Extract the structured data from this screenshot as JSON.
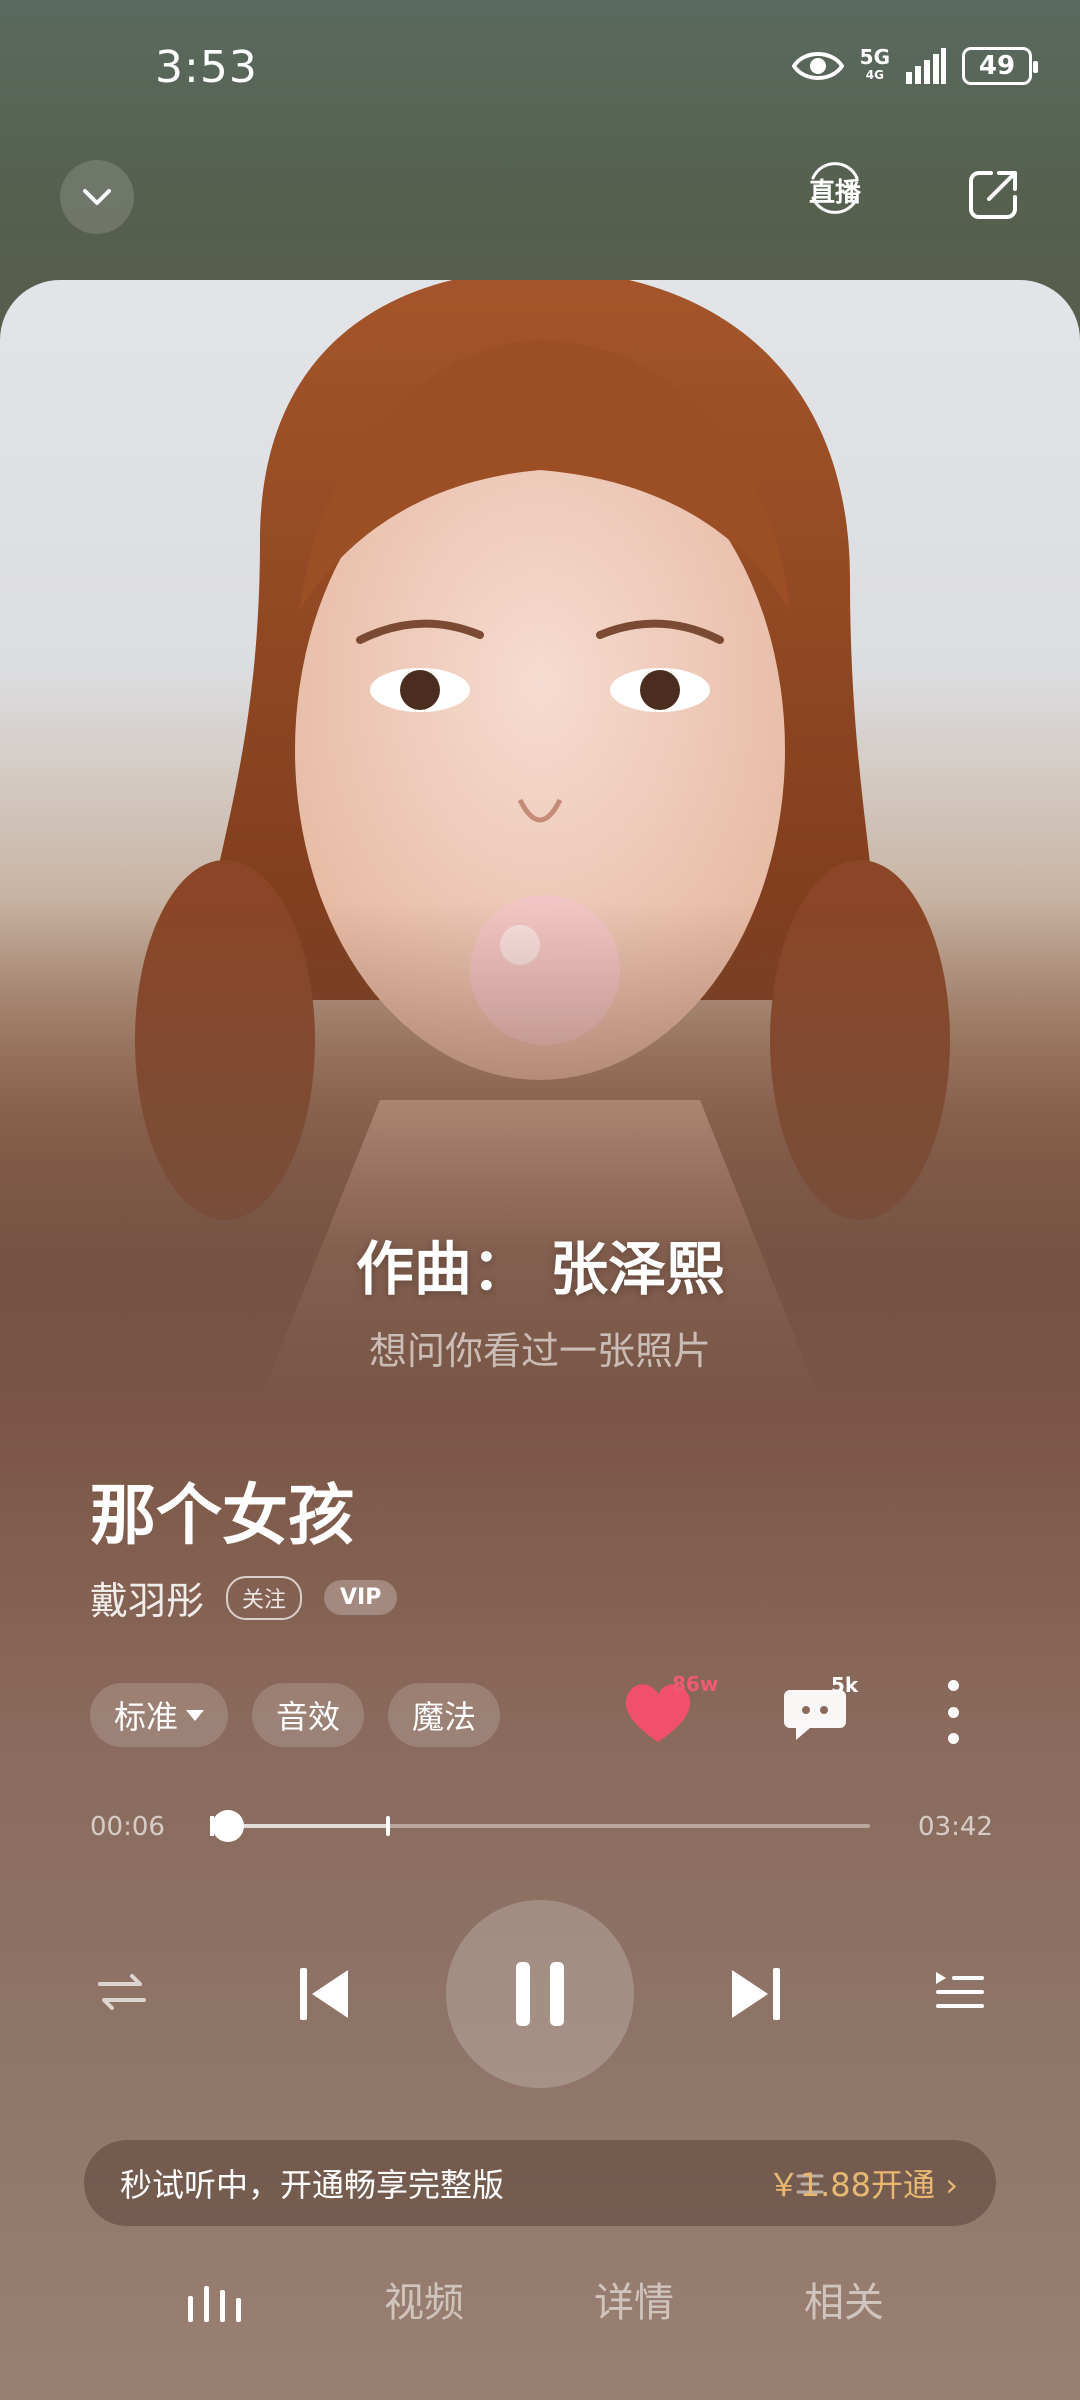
{
  "status_bar": {
    "time": "3:53",
    "network": "5G",
    "network_sub": "4G",
    "battery": "49"
  },
  "header": {
    "live_label": "直播"
  },
  "lyrics": {
    "current": "作曲： 张泽熙",
    "next": "想问你看过一张照片"
  },
  "song": {
    "title": "那个女孩",
    "artist": "戴羽彤",
    "follow_label": "关注",
    "vip_label": "VIP"
  },
  "options": {
    "quality_label": "标准",
    "effects_label": "音效",
    "magic_label": "魔法"
  },
  "stats": {
    "likes": "86w",
    "comments": "5k"
  },
  "progress": {
    "current_time": "00:06",
    "total_time": "03:42",
    "played_fraction": 0.027,
    "buffered_fraction": 0.27
  },
  "trial": {
    "text": "秒试听中，开通畅享完整版",
    "price_label": "￥1.88开通 ›"
  },
  "bottom_nav": {
    "tabs": [
      "视频",
      "详情",
      "相关"
    ]
  },
  "colors": {
    "accent_like": "#f0506a",
    "price": "#e8b873"
  },
  "icons": [
    "chevron-down-icon",
    "live-icon",
    "share-icon",
    "heart-icon",
    "comment-icon",
    "more-icon",
    "repeat-icon",
    "previous-icon",
    "pause-icon",
    "next-icon",
    "playlist-icon",
    "audio-bars-icon"
  ]
}
